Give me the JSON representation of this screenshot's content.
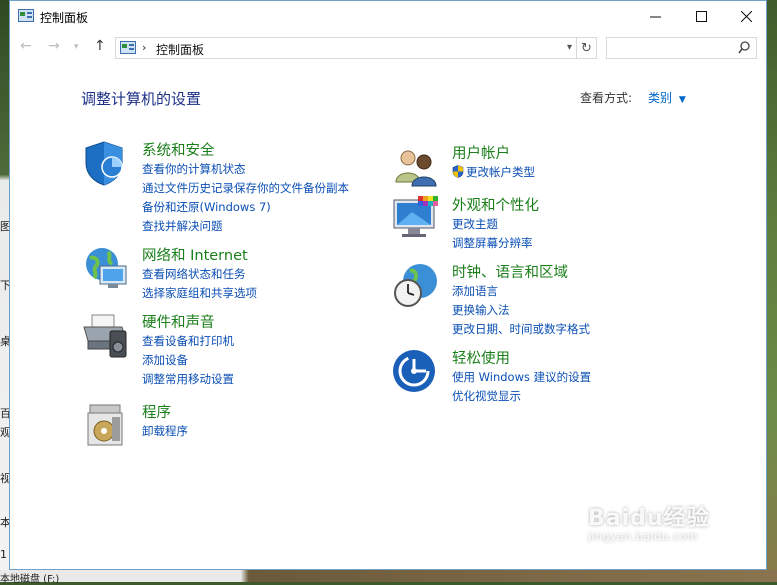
{
  "window": {
    "title": "控制面板"
  },
  "address": {
    "path": "控制面板"
  },
  "search": {
    "placeholder": ""
  },
  "main": {
    "heading": "调整计算机的设置",
    "view_by_label": "查看方式:",
    "view_by_value": "类别"
  },
  "categories": {
    "system_security": {
      "title": "系统和安全",
      "links": [
        "查看你的计算机状态",
        "通过文件历史记录保存你的文件备份副本",
        "备份和还原(Windows 7)",
        "查找并解决问题"
      ]
    },
    "network": {
      "title": "网络和 Internet",
      "links": [
        "查看网络状态和任务",
        "选择家庭组和共享选项"
      ]
    },
    "hardware": {
      "title": "硬件和声音",
      "links": [
        "查看设备和打印机",
        "添加设备",
        "调整常用移动设置"
      ]
    },
    "programs": {
      "title": "程序",
      "links": [
        "卸载程序"
      ]
    },
    "user_accounts": {
      "title": "用户帐户",
      "links": [
        "更改帐户类型"
      ]
    },
    "appearance": {
      "title": "外观和个性化",
      "links": [
        "更改主题",
        "调整屏幕分辨率"
      ]
    },
    "clock_region": {
      "title": "时钟、语言和区域",
      "links": [
        "添加语言",
        "更换输入法",
        "更改日期、时间或数字格式"
      ]
    },
    "ease_of_access": {
      "title": "轻松使用",
      "links": [
        "使用 Windows 建议的设置",
        "优化视觉显示"
      ]
    }
  },
  "background_text": {
    "left_glyphs": [
      "图",
      "下",
      "桌",
      "百",
      "观",
      "视",
      "本",
      "1"
    ],
    "bottom_left": "本地磁盘 (F:)"
  },
  "watermark": {
    "main": "Baidu经验",
    "sub": "jingyan.baidu.com"
  },
  "colors": {
    "heading": "#1e3287",
    "category_title": "#1a7f1a",
    "link": "#0b4fb5",
    "window_border": "#6fa0c8"
  }
}
